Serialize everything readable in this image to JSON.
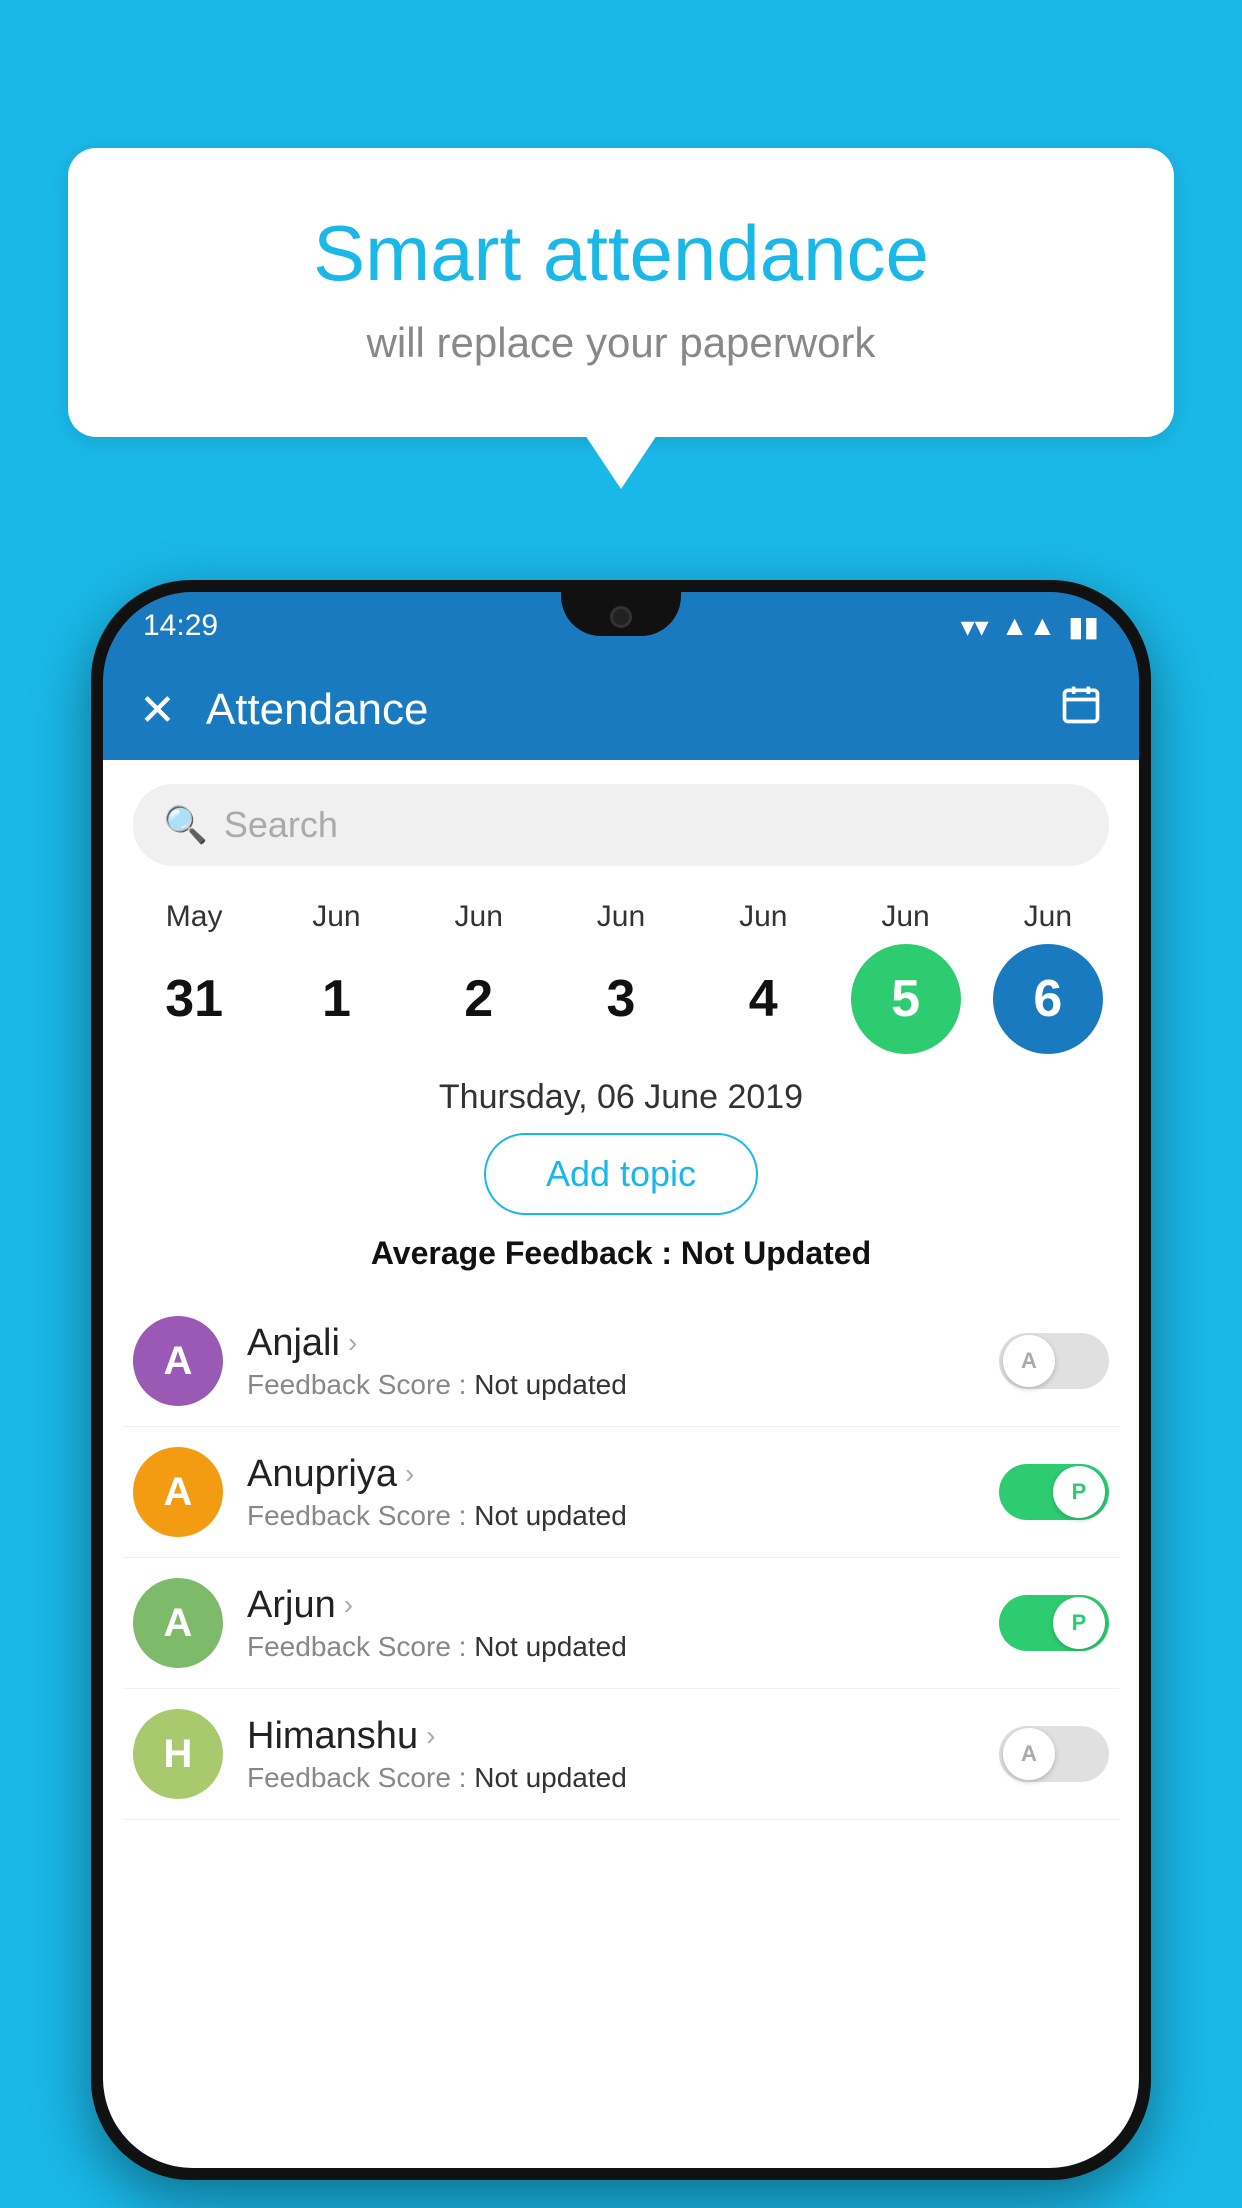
{
  "background_color": "#1ab8e8",
  "bubble": {
    "title": "Smart attendance",
    "subtitle": "will replace your paperwork"
  },
  "status_bar": {
    "time": "14:29",
    "wifi": "▼",
    "signal": "▲",
    "battery": "▮"
  },
  "app_bar": {
    "title": "Attendance",
    "close_icon": "✕",
    "calendar_icon": "📅"
  },
  "search": {
    "placeholder": "Search"
  },
  "calendar": {
    "days": [
      {
        "month": "May",
        "day": "31",
        "state": "normal"
      },
      {
        "month": "Jun",
        "day": "1",
        "state": "normal"
      },
      {
        "month": "Jun",
        "day": "2",
        "state": "normal"
      },
      {
        "month": "Jun",
        "day": "3",
        "state": "normal"
      },
      {
        "month": "Jun",
        "day": "4",
        "state": "normal"
      },
      {
        "month": "Jun",
        "day": "5",
        "state": "today"
      },
      {
        "month": "Jun",
        "day": "6",
        "state": "selected"
      }
    ]
  },
  "selected_date": "Thursday, 06 June 2019",
  "add_topic_label": "Add topic",
  "avg_feedback_label": "Average Feedback : ",
  "avg_feedback_value": "Not Updated",
  "students": [
    {
      "name": "Anjali",
      "initial": "A",
      "avatar_color": "#9b59b6",
      "feedback_label": "Feedback Score : ",
      "feedback_value": "Not updated",
      "toggle_state": "off",
      "toggle_label": "A"
    },
    {
      "name": "Anupriya",
      "initial": "A",
      "avatar_color": "#f39c12",
      "feedback_label": "Feedback Score : ",
      "feedback_value": "Not updated",
      "toggle_state": "on",
      "toggle_label": "P"
    },
    {
      "name": "Arjun",
      "initial": "A",
      "avatar_color": "#7dba6a",
      "feedback_label": "Feedback Score : ",
      "feedback_value": "Not updated",
      "toggle_state": "on",
      "toggle_label": "P"
    },
    {
      "name": "Himanshu",
      "initial": "H",
      "avatar_color": "#a8c96e",
      "feedback_label": "Feedback Score : ",
      "feedback_value": "Not updated",
      "toggle_state": "off",
      "toggle_label": "A"
    }
  ]
}
